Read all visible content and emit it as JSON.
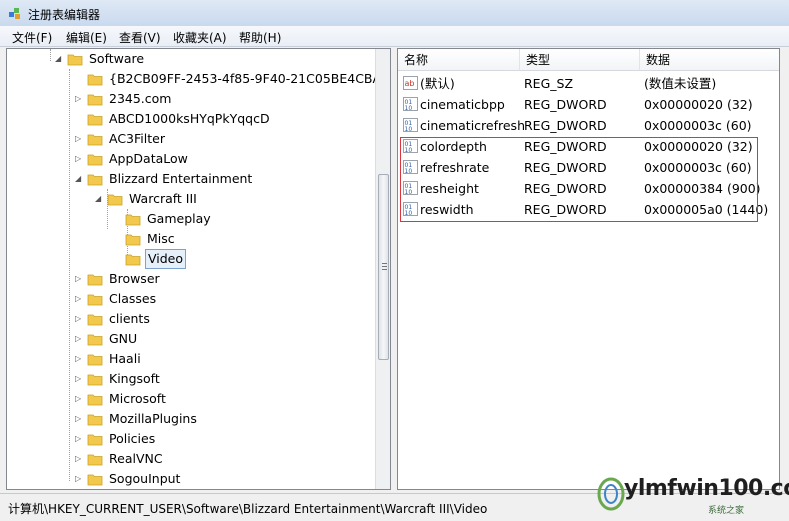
{
  "window": {
    "title": "注册表编辑器"
  },
  "menu": [
    "文件(F)",
    "编辑(E)",
    "查看(V)",
    "收藏夹(A)",
    "帮助(H)"
  ],
  "tree": {
    "root": "Software",
    "items": [
      {
        "label": "{B2CB09FF-2453-4f85-9F40-21C05BE4CBA8}",
        "level": 1,
        "expander": "none"
      },
      {
        "label": "2345.com",
        "level": 1,
        "expander": "collapsed"
      },
      {
        "label": "ABCD1000ksHYqPkYqqcD",
        "level": 1,
        "expander": "none"
      },
      {
        "label": "AC3Filter",
        "level": 1,
        "expander": "collapsed"
      },
      {
        "label": "AppDataLow",
        "level": 1,
        "expander": "collapsed"
      },
      {
        "label": "Blizzard Entertainment",
        "level": 1,
        "expander": "expanded"
      },
      {
        "label": "Warcraft III",
        "level": 2,
        "expander": "expanded"
      },
      {
        "label": "Gameplay",
        "level": 3,
        "expander": "none"
      },
      {
        "label": "Misc",
        "level": 3,
        "expander": "none"
      },
      {
        "label": "Video",
        "level": 3,
        "expander": "none",
        "selected": true
      },
      {
        "label": "Browser",
        "level": 1,
        "expander": "collapsed"
      },
      {
        "label": "Classes",
        "level": 1,
        "expander": "collapsed"
      },
      {
        "label": "clients",
        "level": 1,
        "expander": "collapsed"
      },
      {
        "label": "GNU",
        "level": 1,
        "expander": "collapsed"
      },
      {
        "label": "Haali",
        "level": 1,
        "expander": "collapsed"
      },
      {
        "label": "Kingsoft",
        "level": 1,
        "expander": "collapsed"
      },
      {
        "label": "Microsoft",
        "level": 1,
        "expander": "collapsed"
      },
      {
        "label": "MozillaPlugins",
        "level": 1,
        "expander": "collapsed"
      },
      {
        "label": "Policies",
        "level": 1,
        "expander": "collapsed"
      },
      {
        "label": "RealVNC",
        "level": 1,
        "expander": "collapsed"
      },
      {
        "label": "SogouInput",
        "level": 1,
        "expander": "collapsed"
      }
    ]
  },
  "values": {
    "headers": {
      "name": "名称",
      "type": "类型",
      "data": "数据"
    },
    "rows": [
      {
        "name": "(默认)",
        "type": "REG_SZ",
        "data": "(数值未设置)",
        "icon": "string"
      },
      {
        "name": "cinematicbpp",
        "type": "REG_DWORD",
        "data": "0x00000020 (32)",
        "icon": "binary"
      },
      {
        "name": "cinematicrefresh",
        "type": "REG_DWORD",
        "data": "0x0000003c (60)",
        "icon": "binary"
      },
      {
        "name": "colordepth",
        "type": "REG_DWORD",
        "data": "0x00000020 (32)",
        "icon": "binary"
      },
      {
        "name": "refreshrate",
        "type": "REG_DWORD",
        "data": "0x0000003c (60)",
        "icon": "binary"
      },
      {
        "name": "resheight",
        "type": "REG_DWORD",
        "data": "0x00000384 (900)",
        "icon": "binary"
      },
      {
        "name": "reswidth",
        "type": "REG_DWORD",
        "data": "0x000005a0 (1440)",
        "icon": "binary"
      }
    ]
  },
  "status": {
    "path": "计算机\\HKEY_CURRENT_USER\\Software\\Blizzard Entertainment\\Warcraft III\\Video"
  },
  "watermark": {
    "text": "ylmfwin100.com",
    "sub": "系统之家"
  },
  "colors": {
    "highlight_box": "#d9363e",
    "folder": "#f2c94c",
    "selection": "#e5f0fb"
  }
}
